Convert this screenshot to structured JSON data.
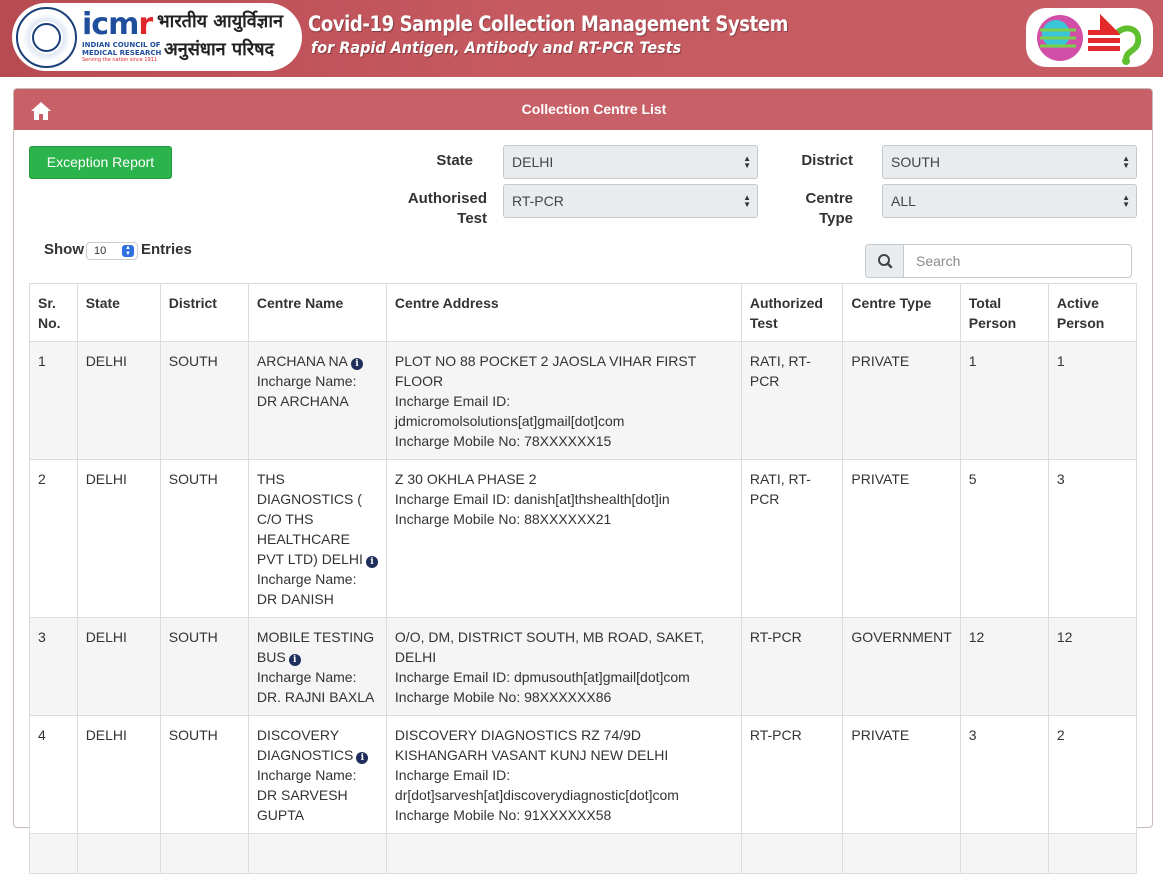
{
  "header": {
    "org_short": "icm",
    "org_short_r": "r",
    "org_full_line1": "INDIAN COUNCIL OF",
    "org_full_line2": "MEDICAL RESEARCH",
    "org_tagline": "Serving the nation since 1911",
    "org_hindi_line1": "भारतीय आयुर्विज्ञान",
    "org_hindi_line2": "अनुसंधान परिषद",
    "system_title": "Covid-19 Sample Collection Management System",
    "system_subtitle": "for Rapid Antigen, Antibody  and RT-PCR Tests",
    "colors": {
      "banner": "#c65a61",
      "card_header": "#c86068",
      "accent_green": "#2bb34c",
      "icmr_blue": "#1f4e9c",
      "icmr_red": "#e0262b"
    }
  },
  "card": {
    "title": "Collection Centre List",
    "home_icon": "home-icon"
  },
  "filters": {
    "exception_button": "Exception Report",
    "state_label": "State",
    "state_value": "DELHI",
    "district_label": "District",
    "district_value": "SOUTH",
    "authorised_label_line1": "Authorised",
    "authorised_label_line2": "Test",
    "authorised_value": "RT-PCR",
    "centre_type_label_line1": "Centre",
    "centre_type_label_line2": "Type",
    "centre_type_value": "ALL"
  },
  "listing": {
    "show_label": "Show",
    "entries_value": "10",
    "entries_label": "Entries",
    "search_placeholder": "Search",
    "search_icon": "search-icon"
  },
  "table": {
    "headers": {
      "sr": "Sr. No.",
      "state": "State",
      "district": "District",
      "centre_name": "Centre Name",
      "centre_address": "Centre Address",
      "authorized_test": "Authorized Test",
      "centre_type": "Centre Type",
      "total_person": "Total Person",
      "active_person": "Active Person"
    },
    "rows": [
      {
        "sr": "1",
        "state": "DELHI",
        "district": "SOUTH",
        "centre_name": "ARCHANA NA",
        "incharge_name": "Incharge Name: DR ARCHANA",
        "address": "PLOT NO 88 POCKET 2 JAOSLA VIHAR FIRST FLOOR",
        "email": "Incharge Email ID: jdmicromolsolutions[at]gmail[dot]com",
        "mobile": "Incharge Mobile No: 78XXXXXX15",
        "test": "RATI, RT-PCR",
        "type": "PRIVATE",
        "total": "1",
        "active": "1"
      },
      {
        "sr": "2",
        "state": "DELHI",
        "district": "SOUTH",
        "centre_name": "THS DIAGNOSTICS ( C/O THS HEALTHCARE PVT LTD) DELHI",
        "incharge_name": "Incharge Name: DR DANISH",
        "address": "Z 30 OKHLA PHASE 2",
        "email": "Incharge Email ID: danish[at]thshealth[dot]in",
        "mobile": "Incharge Mobile No: 88XXXXXX21",
        "test": "RATI, RT-PCR",
        "type": "PRIVATE",
        "total": "5",
        "active": "3"
      },
      {
        "sr": "3",
        "state": "DELHI",
        "district": "SOUTH",
        "centre_name": "MOBILE TESTING BUS",
        "incharge_name": "Incharge Name: DR. RAJNI BAXLA",
        "address": "O/O, DM, DISTRICT SOUTH, MB ROAD, SAKET, DELHI",
        "email": "Incharge Email ID: dpmusouth[at]gmail[dot]com",
        "mobile": "Incharge Mobile No: 98XXXXXX86",
        "test": "RT-PCR",
        "type": "GOVERNMENT",
        "total": "12",
        "active": "12"
      },
      {
        "sr": "4",
        "state": "DELHI",
        "district": "SOUTH",
        "centre_name": "DISCOVERY DIAGNOSTICS",
        "incharge_name": "Incharge Name: DR SARVESH GUPTA",
        "address": "DISCOVERY DIAGNOSTICS RZ 74/9D KISHANGARH VASANT KUNJ NEW DELHI",
        "email": "Incharge Email ID: dr[dot]sarvesh[at]discoverydiagnostic[dot]com",
        "mobile": "Incharge Mobile No: 91XXXXXX58",
        "test": "RT-PCR",
        "type": "PRIVATE",
        "total": "3",
        "active": "2"
      }
    ]
  }
}
